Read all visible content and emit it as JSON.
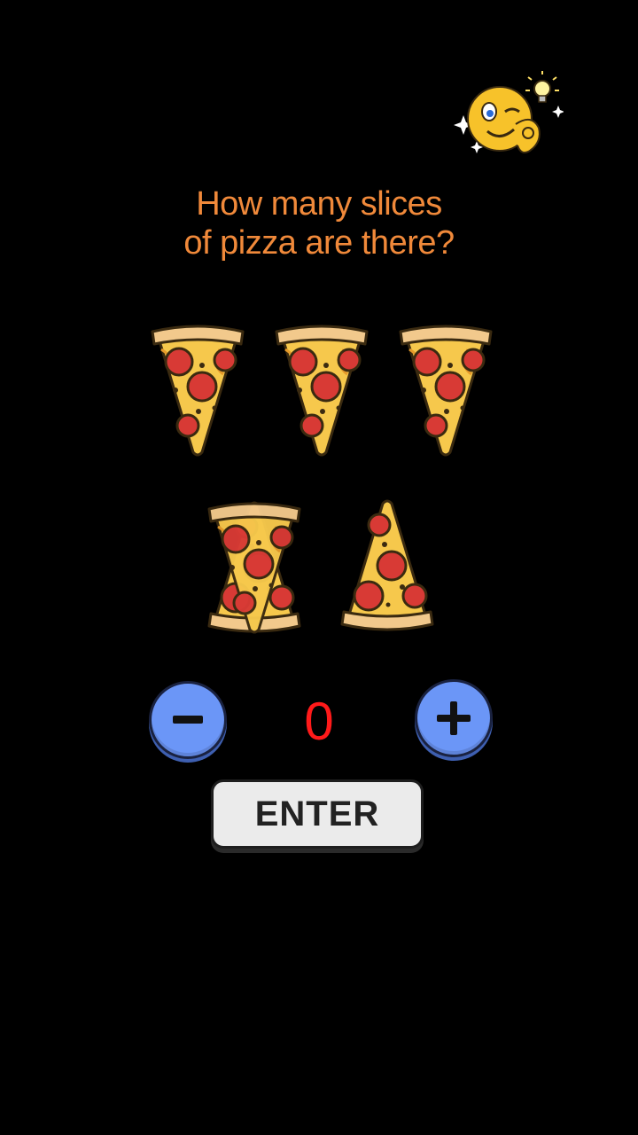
{
  "question": {
    "line1": "How many slices",
    "line2": "of pizza are there?"
  },
  "counter": {
    "value": "0"
  },
  "buttons": {
    "enter_label": "ENTER",
    "minus_icon": "minus-icon",
    "plus_icon": "plus-icon"
  },
  "images": {
    "mascot": "winking-lightbulb-emoji",
    "pizza_slices_shown": 5
  },
  "colors": {
    "background": "#000000",
    "question_text": "#f0893a",
    "counter_text": "#ff1a1a",
    "round_button": "#6b96f7",
    "enter_button": "#ebebeb"
  }
}
